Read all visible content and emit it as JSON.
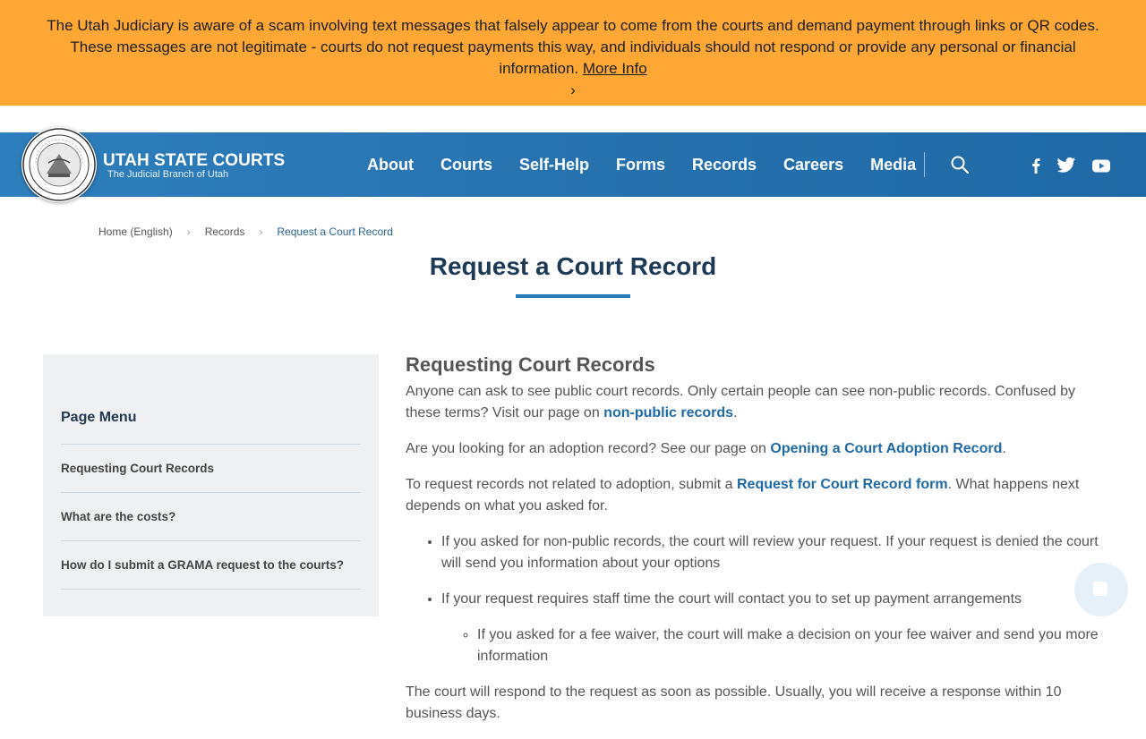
{
  "alert": {
    "message": "The Utah Judiciary is aware of a scam involving text messages that falsely appear to come from the courts and demand payment through links or QR codes. These messages are not legitimate - courts do not request payments this way, and individuals should not respond or provide any personal or financial information.",
    "link_label": "More Info",
    "chevron": "›"
  },
  "header": {
    "brand_title": "UTAH STATE COURTS",
    "brand_subtitle": "The Judicial Branch of Utah",
    "nav": [
      "About",
      "Courts",
      "Self-Help",
      "Forms",
      "Records",
      "Careers",
      "Media"
    ],
    "icons": [
      "search-icon",
      "facebook-icon",
      "twitter-icon",
      "youtube-icon"
    ]
  },
  "breadcrumb": [
    "Home (English)",
    "Records",
    "Request a Court Record"
  ],
  "page_title": "Request a Court Record",
  "sidebar": {
    "heading": "Page Menu",
    "items": [
      "Requesting Court Records",
      "What are the costs?",
      "How do I submit a GRAMA request to the courts?"
    ]
  },
  "content": {
    "heading": "Requesting Court Records",
    "p1_text": "Anyone can ask to see public court records. Only certain people can see non-public records. Confused by these terms? Visit our page on ",
    "p1_link": "non-public records",
    "p1_end": ".",
    "p2_text": "Are you looking for an adoption record? See our page on ",
    "p2_link": "Opening a Court Adoption Record",
    "p2_end": ".",
    "p3_text": "To request records not related to adoption, submit a ",
    "p3_link": "Request for Court Record form",
    "p3_end": ". What happens next depends on what you asked for.",
    "bullets": [
      "If you asked for non-public records, the court will review your request. If your request is denied the court will send you information about your options",
      "If your request requires staff time the court will contact you to set up payment arrangements"
    ],
    "sub_bullet": "If you asked for a fee waiver, the court will make a decision on your fee waiver and send you more information",
    "p4": "The court will respond to the request as soon as possible. Usually, you will receive a response within 10 business days."
  },
  "colors": {
    "alert_bg": "#fea734",
    "nav_bg": "#2671ad",
    "link": "#1f6aa6",
    "title": "#1c3a55",
    "title_rule": "#2a7ab8",
    "sidebar_bg": "#eff0f2"
  }
}
